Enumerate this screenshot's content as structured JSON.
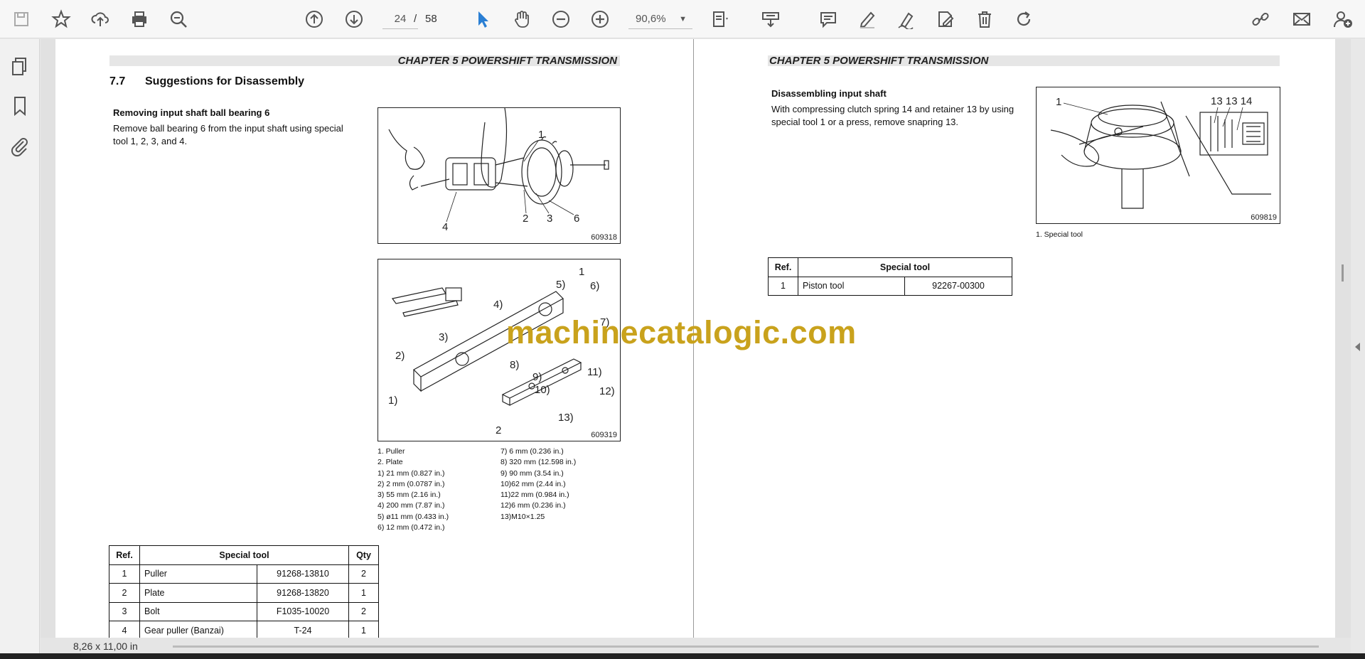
{
  "toolbar": {
    "current_page": "24",
    "page_separator": "/",
    "total_pages": "58",
    "zoom": "90,6%",
    "icons": [
      "save-icon",
      "bookmark-star-icon",
      "upload-cloud-icon",
      "print-icon",
      "zoom-search-icon",
      "page-up-icon",
      "page-down-icon",
      "select-cursor-icon",
      "hand-icon",
      "zoom-out-icon",
      "zoom-in-icon",
      "fit-page-icon",
      "scan-icon",
      "comment-icon",
      "highlight-pen-icon",
      "sign-icon",
      "edit-pdf-icon",
      "delete-icon",
      "rotate-icon",
      "share-link-icon",
      "email-icon",
      "add-user-icon"
    ]
  },
  "sidebar": {
    "icons": [
      "page-thumbnails-icon",
      "bookmarks-icon",
      "attachments-icon"
    ]
  },
  "left_page": {
    "chapter": "CHAPTER 5 POWERSHIFT TRANSMISSION",
    "section_number": "7.7",
    "section_title": "Suggestions for Disassembly",
    "subheading": "Removing input shaft ball bearing 6",
    "body_line1": "Remove ball bearing 6 from the input shaft using special",
    "body_line2": "tool 1, 2, 3, and 4.",
    "fig1_id": "609318",
    "fig2_id": "609319",
    "fig1_labels": [
      "1",
      "2",
      "3",
      "4",
      "6"
    ],
    "fig2_labels": [
      "1",
      "5)",
      "6)",
      "4)",
      "7)",
      "3)",
      "2)",
      "8)",
      "9)",
      "10)",
      "11)",
      "12)",
      "1)",
      "13)",
      "2"
    ],
    "legend_col1": [
      "1. Puller",
      "2. Plate",
      "1) 21 mm (0.827 in.)",
      "2) 2 mm (0.0787 in.)",
      "3) 55 mm (2.16 in.)",
      "4) 200 mm (7.87 in.)",
      "5) ø11 mm (0.433 in.)",
      "6) 12 mm (0.472 in.)"
    ],
    "legend_col2": [
      "7) 6 mm (0.236 in.)",
      "8) 320 mm (12.598 in.)",
      "9) 90 mm (3.54 in.)",
      "10)62 mm (2.44 in.)",
      "11)22 mm (0.984 in.)",
      "12)6 mm (0.236 in.)",
      "13)M10×1.25"
    ],
    "table": {
      "headers": [
        "Ref.",
        "Special tool",
        "Qty"
      ],
      "rows": [
        [
          "1",
          "Puller",
          "91268-13810",
          "2"
        ],
        [
          "2",
          "Plate",
          "91268-13820",
          "1"
        ],
        [
          "3",
          "Bolt",
          "F1035-10020",
          "2"
        ],
        [
          "4",
          "Gear puller (Banzai)",
          "T-24",
          "1"
        ]
      ]
    }
  },
  "right_page": {
    "chapter": "CHAPTER 5 POWERSHIFT TRANSMISSION",
    "subheading": "Disassembling input shaft",
    "body_line1": "With compressing clutch spring 14 and retainer 13 by using",
    "body_line2": "special tool 1 or a press, remove snapring 13.",
    "fig_id": "609819",
    "fig_labels": [
      "1",
      "13 13 14"
    ],
    "fig_caption": "1. Special tool",
    "table": {
      "headers": [
        "Ref.",
        "Special tool"
      ],
      "rows": [
        [
          "1",
          "Piston tool",
          "92267-00300"
        ]
      ]
    }
  },
  "watermark": "machinecatalogic.com",
  "status": {
    "page_size": "8,26 x 11,00 in"
  }
}
